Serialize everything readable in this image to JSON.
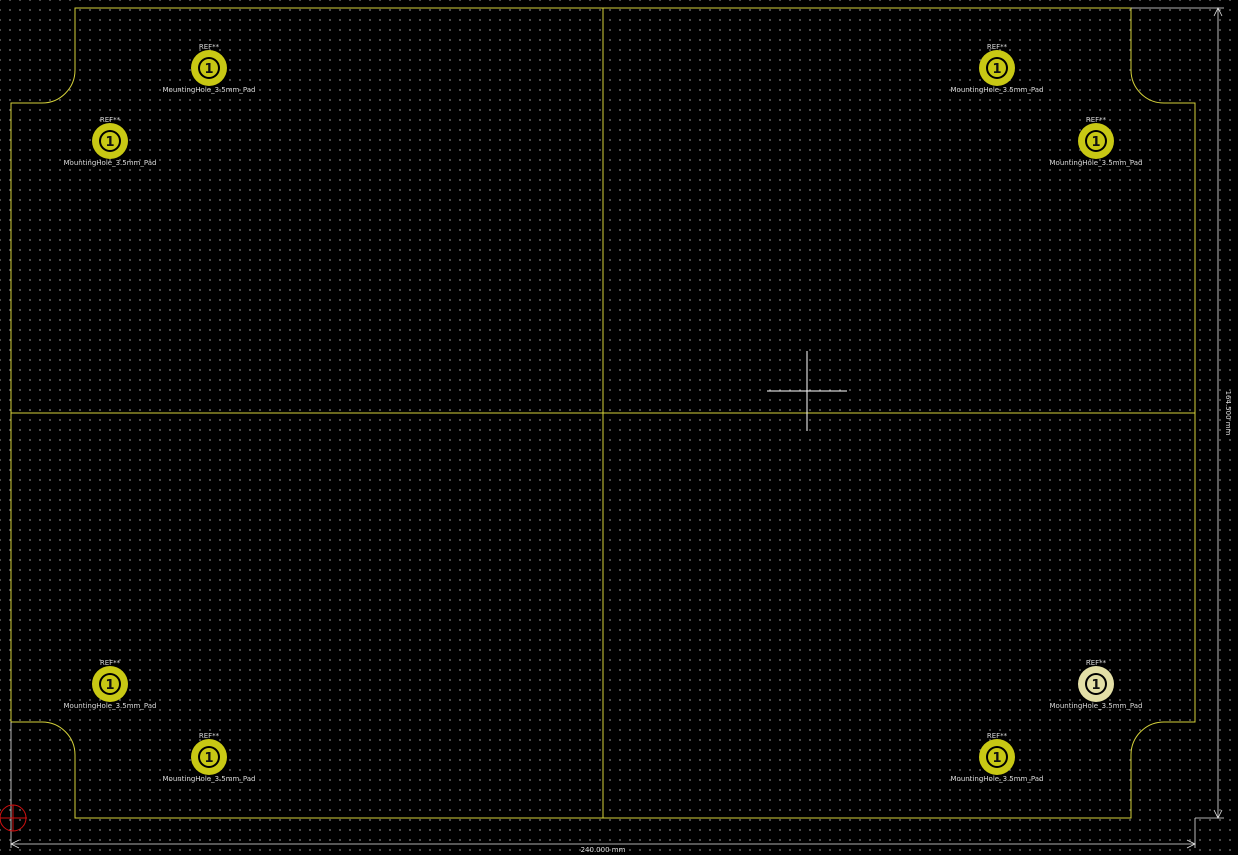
{
  "colors": {
    "background": "#000000",
    "edge_cuts": "#d4d13a",
    "pad_copper": "#c8c814",
    "pad_highlight": "#e3dfa6",
    "dimension": "#e8e8e8",
    "cursor": "#ffffff",
    "origin_marker": "#d01010"
  },
  "board": {
    "outline_name": "board-outline"
  },
  "mounting_holes": [
    {
      "ref": "REF**",
      "value": "MountingHole_3.5mm_Pad",
      "pad_number": "1",
      "highlighted": false
    },
    {
      "ref": "REF**",
      "value": "MountingHole_3.5mm_Pad",
      "pad_number": "1",
      "highlighted": false
    },
    {
      "ref": "REF**",
      "value": "MountingHole_3.5mm_Pad",
      "pad_number": "1",
      "highlighted": false
    },
    {
      "ref": "REF**",
      "value": "MountingHole_3.5mm_Pad",
      "pad_number": "1",
      "highlighted": false
    },
    {
      "ref": "REF**",
      "value": "MountingHole_3.5mm_Pad",
      "pad_number": "1",
      "highlighted": false
    },
    {
      "ref": "REF**",
      "value": "MountingHole_3.5mm_Pad",
      "pad_number": "1",
      "highlighted": true
    },
    {
      "ref": "REF**",
      "value": "MountingHole_3.5mm_Pad",
      "pad_number": "1",
      "highlighted": false
    },
    {
      "ref": "REF**",
      "value": "MountingHole_3.5mm_Pad",
      "pad_number": "1",
      "highlighted": false
    }
  ],
  "dimensions": {
    "width_label": "240.000 mm",
    "height_label": "164.500 mm"
  },
  "icons": {
    "cursor": "crosshair-cursor-icon",
    "origin": "origin-marker-icon"
  }
}
